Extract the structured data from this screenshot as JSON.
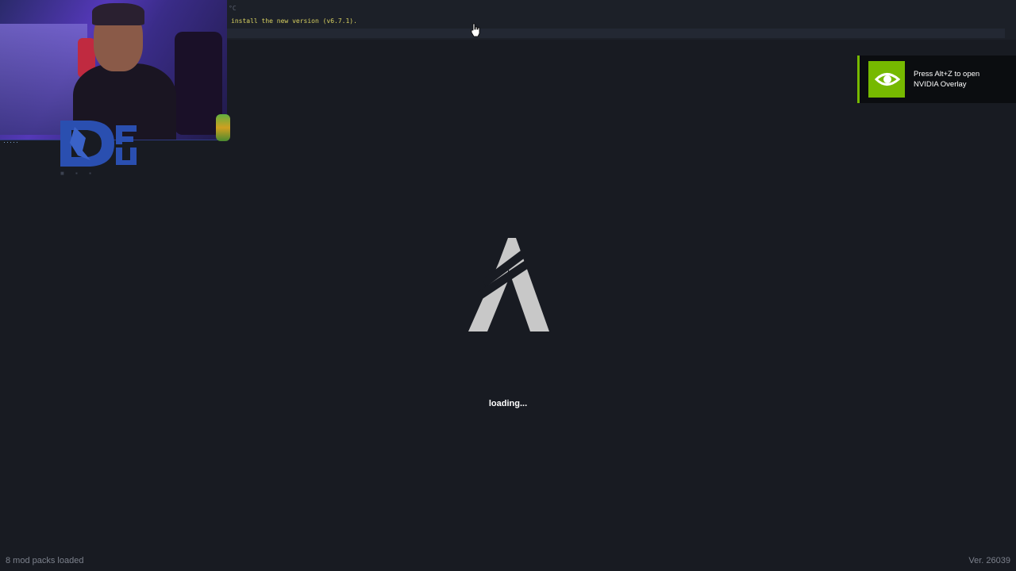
{
  "console": {
    "temp_text": "°C",
    "message": "install the new version (v6.7.1)."
  },
  "webcam": {
    "label": "webcam-overlay",
    "logo_sub": "■ ▪ ▪"
  },
  "nvidia_toast": {
    "line1": "Press Alt+Z to open",
    "line2": "NVIDIA Overlay",
    "accent": "#76b900"
  },
  "loading_screen": {
    "status": "loading...",
    "mods_loaded": "8 mod packs loaded",
    "version": "Ver. 26039"
  },
  "colors": {
    "background": "#181b22",
    "console_text": "#d8d060",
    "footer_text": "#7c818c"
  }
}
